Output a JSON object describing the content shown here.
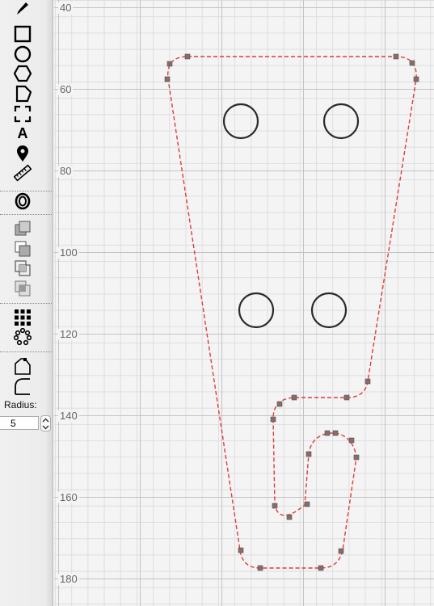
{
  "toolbar": {
    "tools": [
      {
        "name": "pencil-icon",
        "glyph": "pencil"
      },
      {
        "name": "rectangle-icon"
      },
      {
        "name": "circle-icon"
      },
      {
        "name": "hexagon-icon"
      },
      {
        "name": "pentagon-icon"
      },
      {
        "name": "dashed-rect-icon"
      },
      {
        "name": "text-icon",
        "label": "A"
      },
      {
        "name": "map-pin-icon"
      },
      {
        "name": "ruler-icon"
      },
      {
        "name": "offset-icon",
        "label": "O"
      },
      {
        "name": "union-icon"
      },
      {
        "name": "subtract-icon"
      },
      {
        "name": "intersect-icon"
      },
      {
        "name": "exclude-icon"
      },
      {
        "name": "grid-array-icon"
      },
      {
        "name": "circular-array-icon"
      },
      {
        "name": "chamfer-icon"
      },
      {
        "name": "fillet-icon"
      }
    ],
    "radius_label": "Radius:",
    "radius_value": "5"
  },
  "ruler": {
    "labels": [
      "40",
      "60",
      "80",
      "100",
      "120",
      "140",
      "160",
      "180"
    ]
  },
  "colors": {
    "path": "#e03a3a",
    "node": "#8a6a6a",
    "hole": "#2a2a2a",
    "grid_major": "#c3c3c3",
    "grid_minor": "#dedede"
  }
}
